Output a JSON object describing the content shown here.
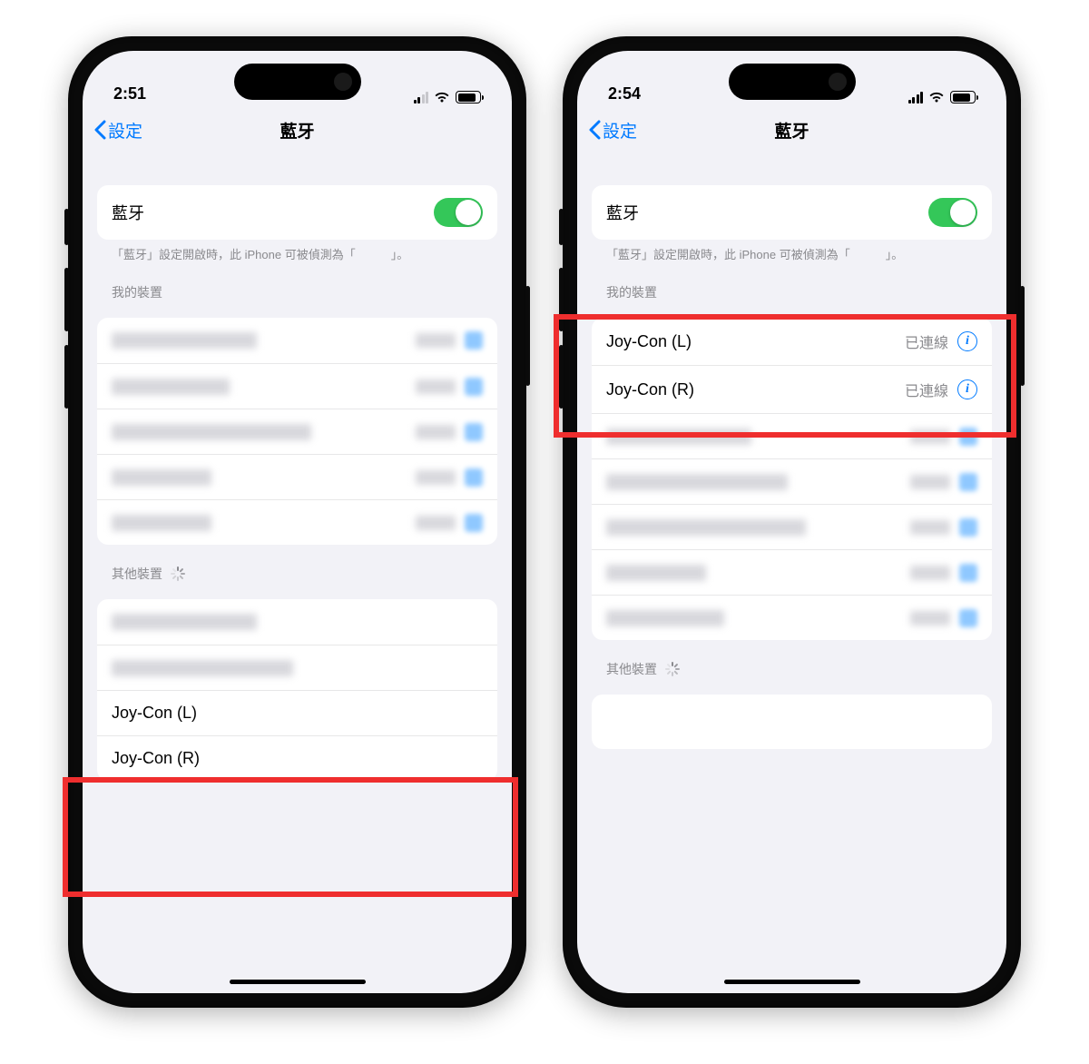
{
  "left": {
    "status_time": "2:51",
    "signal_strength": "weak",
    "nav_back": "設定",
    "nav_title": "藍牙",
    "bt_row_label": "藍牙",
    "bt_on": true,
    "note": "「藍牙」設定開啟時，此 iPhone 可被偵測為「　　　」。",
    "my_devices_header": "我的裝置",
    "other_devices_header": "其他裝置",
    "my_devices": [
      {
        "name_blur_w": "w160"
      },
      {
        "name_blur_w": "w130"
      },
      {
        "name_blur_w": "w220"
      },
      {
        "name_blur_w": "w110"
      },
      {
        "name_blur_w": "w110"
      }
    ],
    "other_devices": [
      {
        "name": "",
        "blur": "w160"
      },
      {
        "name": "",
        "blur": "w200"
      },
      {
        "name": "Joy-Con (L)"
      },
      {
        "name": "Joy-Con (R)"
      }
    ]
  },
  "right": {
    "status_time": "2:54",
    "signal_strength": "full",
    "nav_back": "設定",
    "nav_title": "藍牙",
    "bt_row_label": "藍牙",
    "bt_on": true,
    "note": "「藍牙」設定開啟時，此 iPhone 可被偵測為「　　　」。",
    "my_devices_header": "我的裝置",
    "other_devices_header": "其他裝置",
    "connected_label": "已連線",
    "my_devices": [
      {
        "name": "Joy-Con (L)",
        "status": "已連線"
      },
      {
        "name": "Joy-Con (R)",
        "status": "已連線"
      },
      {
        "name_blur_w": "w160"
      },
      {
        "name_blur_w": "w200"
      },
      {
        "name_blur_w": "w220"
      },
      {
        "name_blur_w": "w110"
      },
      {
        "name_blur_w": "w130"
      }
    ]
  }
}
